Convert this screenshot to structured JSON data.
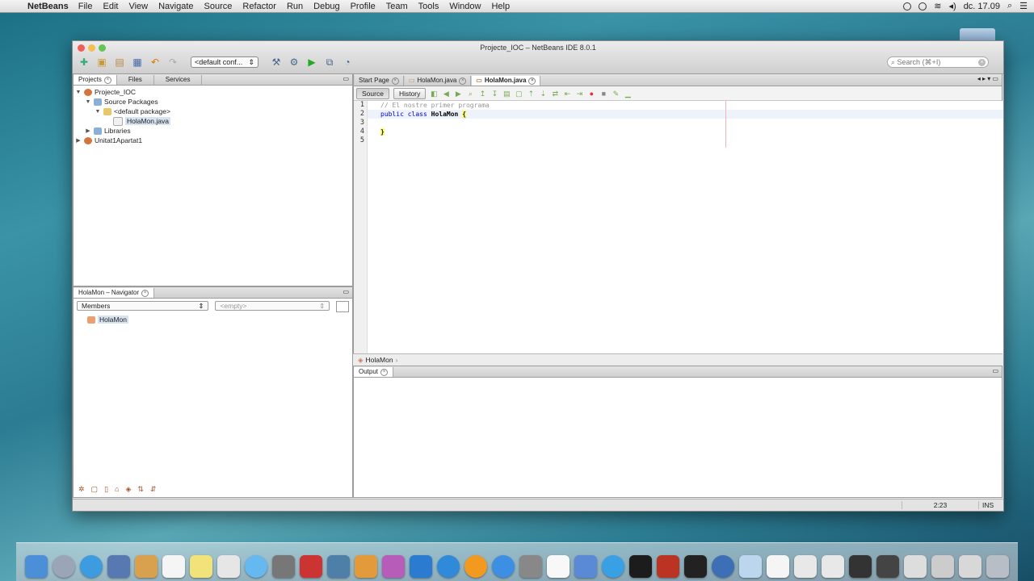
{
  "menubar": {
    "app": "NetBeans",
    "items": [
      "File",
      "Edit",
      "View",
      "Navigate",
      "Source",
      "Refactor",
      "Run",
      "Debug",
      "Profile",
      "Team",
      "Tools",
      "Window",
      "Help"
    ],
    "clock": "dc. 17.09"
  },
  "window": {
    "title": "Projecte_IOC – NetBeans IDE 8.0.1",
    "config": "<default conf...",
    "search_placeholder": "Search (⌘+I)"
  },
  "projects_panel": {
    "tabs": [
      "Projects",
      "Files",
      "Services"
    ],
    "tree": [
      {
        "label": "Projecte_IOC",
        "level": 0,
        "expanded": true
      },
      {
        "label": "Source Packages",
        "level": 1,
        "expanded": true
      },
      {
        "label": "<default package>",
        "level": 2,
        "expanded": true
      },
      {
        "label": "HolaMon.java",
        "level": 3,
        "selected": true
      },
      {
        "label": "Libraries",
        "level": 1,
        "expanded": false
      },
      {
        "label": "Unitat1Apartat1",
        "level": 0,
        "expanded": false
      }
    ]
  },
  "navigator": {
    "title": "HolaMon – Navigator",
    "members": "Members",
    "filter": "<empty>",
    "items": [
      "HolaMon"
    ]
  },
  "editor": {
    "tabs": [
      {
        "label": "Start Page",
        "active": false
      },
      {
        "label": "HolaMon.java",
        "active": false
      },
      {
        "label": "HolaMon.java",
        "active": true
      }
    ],
    "source_label": "Source",
    "history_label": "History",
    "lines": [
      "1",
      "2",
      "3",
      "4",
      "5"
    ],
    "code": {
      "comment": "// El nostre primer programa",
      "kw_public": "public",
      "kw_class": "class",
      "class_name": "HolaMon",
      "open_brace": "{",
      "close_brace": "}"
    },
    "breadcrumb": "HolaMon"
  },
  "output": {
    "tab": "Output"
  },
  "status": {
    "position": "2:23",
    "mode": "INS"
  },
  "colors": {
    "keyword": "#0000e6",
    "comment": "#969696",
    "brace_highlight": "#ffff66"
  }
}
